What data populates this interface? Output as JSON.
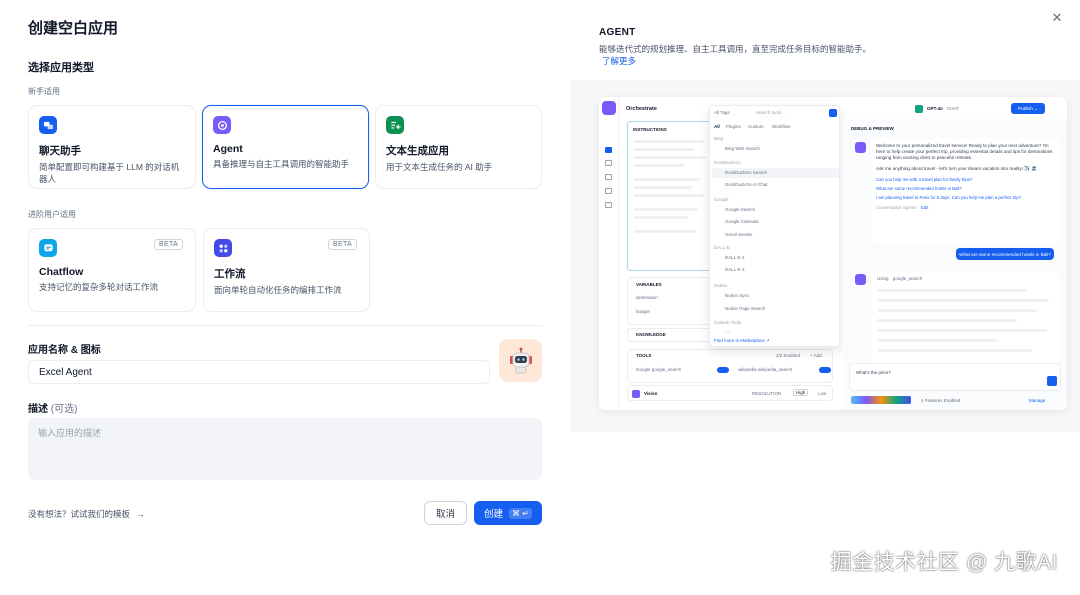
{
  "dialog": {
    "title": "创建空白应用",
    "section_type": "选择应用类型",
    "group_beginner": "新手适用",
    "group_advanced": "进阶用户适用",
    "app_types": [
      {
        "name": "聊天助手",
        "desc": "简单配置即可构建基于 LLM 的对话机器人",
        "color": "#155eef",
        "icon": "chat-bubble-icon"
      },
      {
        "name": "Agent",
        "desc": "具备推理与自主工具调用的智能助手",
        "color": "#7a5af8",
        "icon": "agent-icon",
        "selected": true
      },
      {
        "name": "文本生成应用",
        "desc": "用于文本生成任务的 AI 助手",
        "color": "#099250",
        "icon": "text-generate-icon"
      },
      {
        "name": "Chatflow",
        "desc": "支持记忆的复杂多轮对话工作流",
        "color": "#0ba5ec",
        "icon": "chatflow-icon",
        "badge": "BETA"
      },
      {
        "name": "工作流",
        "desc": "面向单轮自动化任务的编排工作流",
        "color": "#444ce7",
        "icon": "workflow-icon",
        "badge": "BETA"
      }
    ],
    "name_label": "应用名称 & 图标",
    "name_value": "Excel Agent",
    "desc_label": "描述",
    "desc_optional": "(可选)",
    "desc_placeholder": "输入应用的描述",
    "template_link": "没有想法？试试我们的模板",
    "cancel_label": "取消",
    "create_label": "创建",
    "create_shortcut": "⌘ ↵"
  },
  "preview": {
    "title": "AGENT",
    "desc": "能够迭代式的规划推理、自主工具调用，直至完成任务目标的智能助手。",
    "learn_more": "了解更多",
    "mock": {
      "orchestrate": "Orchestrate",
      "instructions": "INSTRUCTIONS",
      "variables": "VARIABLES",
      "var_items": [
        "destination",
        "budget"
      ],
      "knowledge": "KNOWLEDGE",
      "tools": "TOOLS",
      "tools_count": "2/2 Enabled",
      "tools_add": "+ Add",
      "tool_items": [
        "Google  google_search",
        "wikipedia  wikipedia_search"
      ],
      "vision": "Vision",
      "resolution": "RESOLUTION",
      "res_high": "High",
      "res_low": "Low",
      "dropdown_tab": "All Tags",
      "dropdown_search": "Search tools...",
      "dropdown_filters": [
        "All",
        "Plugins",
        "Custom",
        "Workflow"
      ],
      "dropdown_groups": [
        {
          "group": "Bing",
          "items": [
            "Bing Web Search"
          ]
        },
        {
          "group": "DuckDuckGo",
          "items": [
            "DuckDuckGo Search",
            "DuckDuckGo AI Chat"
          ]
        },
        {
          "group": "Google",
          "items": [
            "Google Search",
            "Google Calendar",
            "Gmail Sender"
          ]
        },
        {
          "group": "DALL-E",
          "items": [
            "DALL-E 2",
            "DALL-E 3"
          ]
        },
        {
          "group": "Notion",
          "items": [
            "Notion Sync",
            "Notion Page Search"
          ]
        },
        {
          "group": "Custom Tools",
          "items": [
            "...."
          ]
        }
      ],
      "find_more": "Find more in Marketplace ↗",
      "model": "GPT-4o",
      "model_tag": "CHAT",
      "publish": "Publish ⌄",
      "debug": "DEBUG & PREVIEW",
      "welcome": "Welcome to your personalized travel service! Ready to plan your next adventure? I'm here to help create your perfect trip, providing essential details and tips for destinations ranging from exciting cities to peaceful retreats.",
      "ask": "Ask me anything about travel - let's turn your dream vacation into reality! ✈️ 🏖",
      "suggestions": [
        "Can you help me with a travel plan for family trips?",
        "What are some recommended hotels in Bali?",
        "I am planning travel to Paris for 5 days. Can you help me plan a perfect trip?"
      ],
      "opener": "Conversation Opener",
      "opener_edit": "Edit",
      "user_msg": "What are some recommended hotels in Bali?",
      "using": "Using",
      "using_tool": "google_search",
      "input_placeholder": "What's the price?",
      "features": "4 Features Enabled",
      "manage": "Manage"
    }
  },
  "watermark": "掘金技术社区 @ 九歌AI"
}
